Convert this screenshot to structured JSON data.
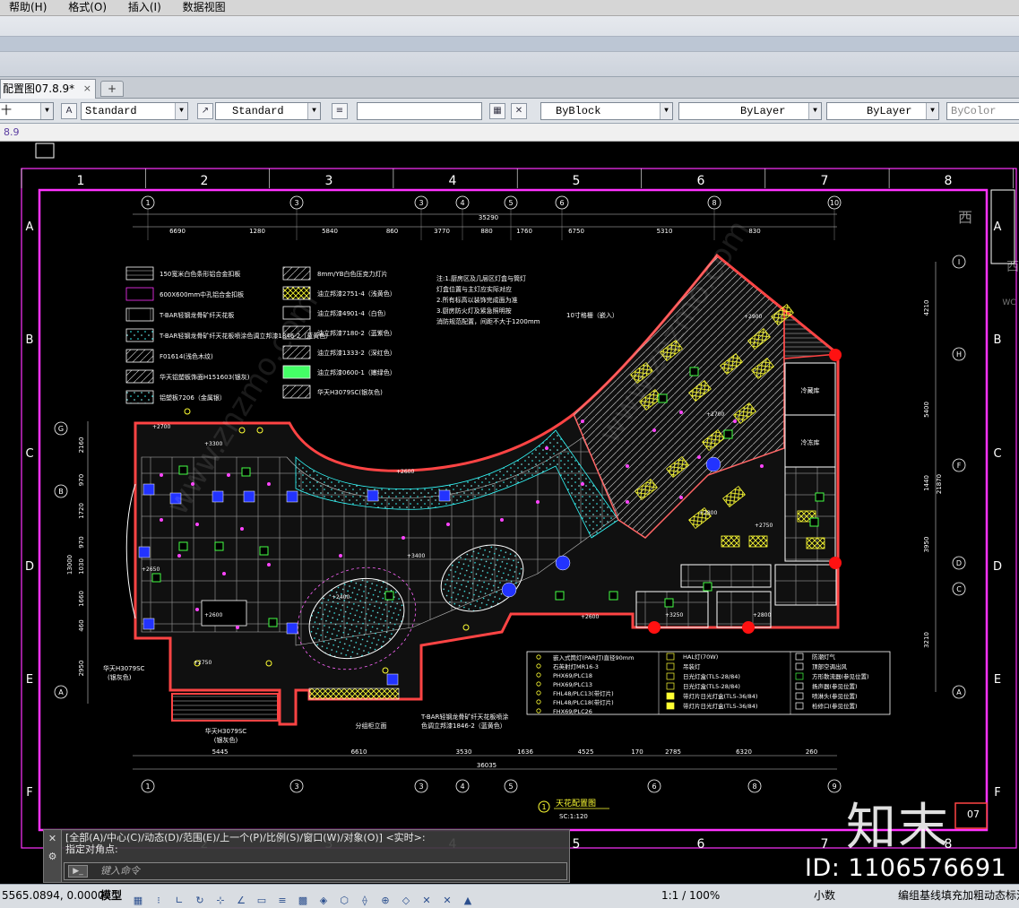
{
  "menu": {
    "items": [
      "帮助(H)",
      "格式(O)",
      "插入(I)",
      "数据视图"
    ]
  },
  "document_tab": {
    "title": "配置图07.8.9*",
    "close": "×",
    "add": "+"
  },
  "toolbar": {
    "layer_stub": "十",
    "text_style": "Standard",
    "dim_style": "Standard",
    "color": "ByBlock",
    "linetype": "ByLayer",
    "lineweight": "ByLayer",
    "plotstyle": "ByColor"
  },
  "command_echo": "8.9",
  "drawing": {
    "title": "天花配置图",
    "scale": "SC:1:120",
    "title_index": "1",
    "sheet_number": "07",
    "grid_columns": [
      "1",
      "2",
      "3",
      "4",
      "5",
      "6",
      "7",
      "8"
    ],
    "grid_rows": [
      "A",
      "B",
      "C",
      "D",
      "E",
      "F"
    ],
    "axis_top": [
      "1",
      "3",
      "3",
      "4",
      "5",
      "6",
      "8",
      "10"
    ],
    "axis_bottom": [
      "1",
      "3",
      "3",
      "4",
      "5",
      "6",
      "8",
      "9"
    ],
    "axis_right": [
      "I",
      "H",
      "F",
      "D",
      "C",
      "A"
    ],
    "axis_left": [
      "G",
      "B",
      "A"
    ],
    "top_dims": [
      "6690",
      "1280",
      "5840",
      "860",
      "3770",
      "880",
      "1760",
      "6750",
      "5310",
      "830"
    ],
    "top_total": "35290",
    "bottom_dims": [
      "5445",
      "6610",
      "3530",
      "1636",
      "4525",
      "170",
      "2785",
      "6320",
      "260"
    ],
    "bottom_total": "36035",
    "right_dims": [
      "4210",
      "5400",
      "1440",
      "3950",
      "3210"
    ],
    "right_total": "21870",
    "left_dims": [
      "2160",
      "970",
      "1720",
      "970",
      "1030",
      "1660",
      "460",
      "2950"
    ],
    "left_total": "13000",
    "legend_left": [
      "150宽米白色条形铝合金扣板",
      "600X600mm中孔铝合金扣板",
      "T-BAR轻钢龙骨矿纤天花板",
      "T-BAR轻钢龙骨矿纤天花板喷涂色调立邦漆1846-2（蓝黄色）",
      "F01614(浅色木纹)",
      "华天铝塑板饰面H151603(银灰)",
      "铝塑板7206（金属银）"
    ],
    "legend_mid": [
      "8mm/YB白色压克力灯片",
      "油立邦漆2751-4（浅黄色）",
      "油立邦漆4901-4（白色）",
      "油立邦漆7180-2（蓝紫色）",
      "油立邦漆1333-2（深红色）",
      "油立邦漆0600-1（嫩绿色）",
      "华天H3079SC(银灰色)"
    ],
    "notes": [
      "注:1.厨房区及几层区灯盒与筒灯",
      "灯盒位置与主灯应实际对应",
      "2.所有标高以装饰完成面为准",
      "3.厨房防火灯及紧急照明按",
      "消防规范配置，间距不大于1200mm"
    ],
    "callout_recess": "10寸格栅（嵌入）",
    "label_cold_room": "冷藏库",
    "label_freezer": "冷冻库",
    "label_partition": "分组柜立面",
    "label_left_a": "华天H3079SC",
    "label_left_b": "(银灰色)",
    "label_bottom_a": "华天H3079SC",
    "label_bottom_b": "(银灰色)",
    "label_bottom_right_a": "T-BAR轻钢龙骨矿纤天花板喷涂",
    "label_bottom_right_b": "色调立邦漆1846-2（蓝黄色）",
    "elevations": [
      "+2700",
      "+3300",
      "+2600",
      "+2650",
      "+2600",
      "+2750",
      "+2400",
      "+3400",
      "+2600",
      "+2800",
      "+2750",
      "+3250",
      "+2800",
      "+2900",
      "+2700"
    ],
    "fixture_legend_left": [
      "嵌入式筒灯(PAR灯)直径90mm",
      "石英射灯MR16-3",
      "PHX69/PLC18",
      "PHX69/PLC13",
      "FHL48/PLC13(带灯片)",
      "FHL48/PLC18(带灯片)",
      "FHX69/PLC26"
    ],
    "fixture_legend_mid": [
      "HAL灯(70W)",
      "吊装灯",
      "日光灯盒(TL5-28/84)",
      "日光灯盒(TL5-28/84)",
      "带灯片日光灯盒(TL5-36/84)",
      "带灯片日光灯盒(TL5-36/84)"
    ],
    "fixture_legend_right": [
      "防潮灯气",
      "顶部空调出风",
      "方形散流器(参见位置)",
      "扬声器(参见位置)",
      "喷淋头(参见位置)",
      "检修口(参见位置)"
    ],
    "right_edge_glyphs": [
      "西",
      "西",
      "WC"
    ]
  },
  "command_line": {
    "history_1": "[全部(A)/中心(C)/动态(D)/范围(E)/上一个(P)/比例(S)/窗口(W)/对象(O)] <实时>:",
    "history_2": "指定对角点:",
    "placeholder": "键入命令",
    "close": "✕",
    "tools": "⚙"
  },
  "status": {
    "coords": "5565.0894, 0.0000",
    "model": "模型",
    "scale": "1:1 / 100%",
    "units": "小数",
    "note": "编组基线填充加粗动态标注"
  },
  "watermark": {
    "brand": "知末",
    "id": "ID: 1106576691",
    "diagonal": "www.znzmo.com"
  },
  "colors": {
    "paper_frame": "#ff33ff",
    "walls": "#ff4444",
    "grid": "#ffffff",
    "fixture_yellow": "#ffff33",
    "tile_cyan": "#33ffff",
    "green": "#44ff44",
    "blue": "#2233ff"
  }
}
